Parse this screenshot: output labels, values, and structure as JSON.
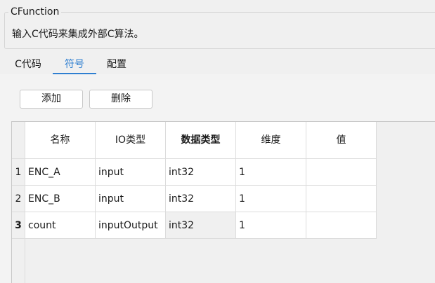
{
  "group": {
    "title": "CFunction",
    "description": "输入C代码来集成外部C算法。"
  },
  "tabs": [
    {
      "label": "C代码",
      "active": false
    },
    {
      "label": "符号",
      "active": true
    },
    {
      "label": "配置",
      "active": false
    }
  ],
  "toolbar": {
    "add_label": "添加",
    "delete_label": "删除"
  },
  "table": {
    "columns": [
      "名称",
      "IO类型",
      "数据类型",
      "维度",
      "值"
    ],
    "rows": [
      {
        "num": "1",
        "name": "ENC_A",
        "io": "input",
        "type": "int32",
        "dim": "1",
        "value": ""
      },
      {
        "num": "2",
        "name": "ENC_B",
        "io": "input",
        "type": "int32",
        "dim": "1",
        "value": ""
      },
      {
        "num": "3",
        "name": "count",
        "io": "inputOutput",
        "type": "int32",
        "dim": "1",
        "value": ""
      }
    ]
  },
  "colors": {
    "accent": "#2f7fd1",
    "background": "#f0f0f0"
  }
}
